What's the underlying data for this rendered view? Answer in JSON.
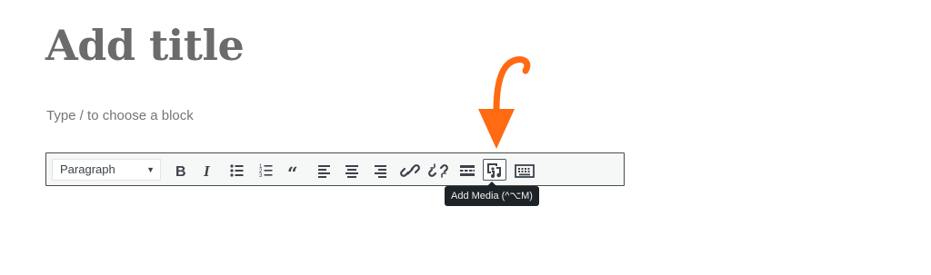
{
  "editor": {
    "title_placeholder": "Add title",
    "block_hint": "Type / to choose a block"
  },
  "toolbar": {
    "format_select": {
      "value": "Paragraph"
    },
    "buttons": [
      {
        "name": "bold",
        "icon": "bold-icon"
      },
      {
        "name": "italic",
        "icon": "italic-icon"
      },
      {
        "name": "bulleted-list",
        "icon": "bulleted-list-icon"
      },
      {
        "name": "numbered-list",
        "icon": "numbered-list-icon"
      },
      {
        "name": "blockquote",
        "icon": "quote-icon"
      },
      {
        "name": "align-left",
        "icon": "align-left-icon"
      },
      {
        "name": "align-center",
        "icon": "align-center-icon"
      },
      {
        "name": "align-right",
        "icon": "align-right-icon"
      },
      {
        "name": "insert-link",
        "icon": "link-icon"
      },
      {
        "name": "remove-link",
        "icon": "unlink-icon"
      },
      {
        "name": "read-more",
        "icon": "read-more-icon"
      },
      {
        "name": "add-media",
        "icon": "add-media-icon",
        "active": true
      },
      {
        "name": "toolbar-toggle",
        "icon": "keyboard-icon"
      }
    ]
  },
  "tooltip": {
    "text": "Add Media (^⌥M)"
  },
  "annotation": {
    "arrow_color": "#ff6a13"
  }
}
